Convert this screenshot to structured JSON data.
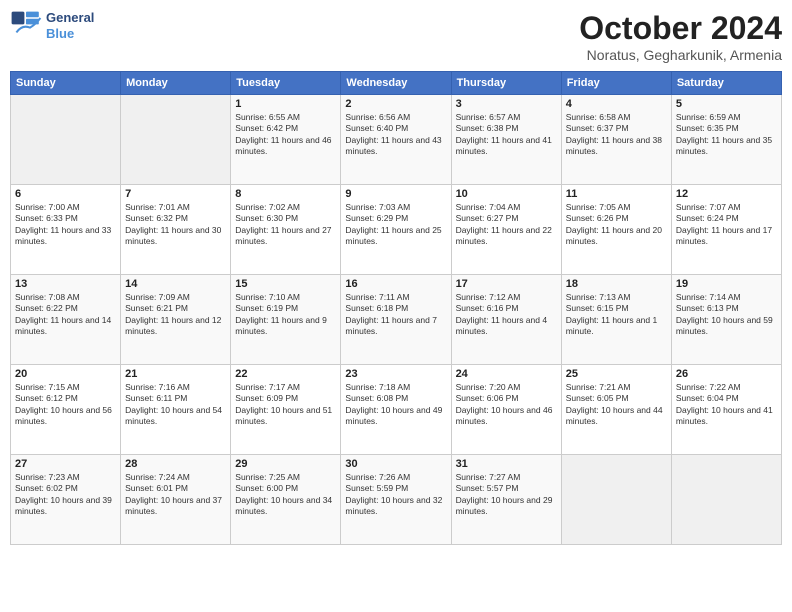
{
  "header": {
    "logo_line1": "General",
    "logo_line2": "Blue",
    "month": "October 2024",
    "location": "Noratus, Gegharkunik, Armenia"
  },
  "weekdays": [
    "Sunday",
    "Monday",
    "Tuesday",
    "Wednesday",
    "Thursday",
    "Friday",
    "Saturday"
  ],
  "weeks": [
    [
      {
        "day": "",
        "info": ""
      },
      {
        "day": "",
        "info": ""
      },
      {
        "day": "1",
        "info": "Sunrise: 6:55 AM\nSunset: 6:42 PM\nDaylight: 11 hours and 46 minutes."
      },
      {
        "day": "2",
        "info": "Sunrise: 6:56 AM\nSunset: 6:40 PM\nDaylight: 11 hours and 43 minutes."
      },
      {
        "day": "3",
        "info": "Sunrise: 6:57 AM\nSunset: 6:38 PM\nDaylight: 11 hours and 41 minutes."
      },
      {
        "day": "4",
        "info": "Sunrise: 6:58 AM\nSunset: 6:37 PM\nDaylight: 11 hours and 38 minutes."
      },
      {
        "day": "5",
        "info": "Sunrise: 6:59 AM\nSunset: 6:35 PM\nDaylight: 11 hours and 35 minutes."
      }
    ],
    [
      {
        "day": "6",
        "info": "Sunrise: 7:00 AM\nSunset: 6:33 PM\nDaylight: 11 hours and 33 minutes."
      },
      {
        "day": "7",
        "info": "Sunrise: 7:01 AM\nSunset: 6:32 PM\nDaylight: 11 hours and 30 minutes."
      },
      {
        "day": "8",
        "info": "Sunrise: 7:02 AM\nSunset: 6:30 PM\nDaylight: 11 hours and 27 minutes."
      },
      {
        "day": "9",
        "info": "Sunrise: 7:03 AM\nSunset: 6:29 PM\nDaylight: 11 hours and 25 minutes."
      },
      {
        "day": "10",
        "info": "Sunrise: 7:04 AM\nSunset: 6:27 PM\nDaylight: 11 hours and 22 minutes."
      },
      {
        "day": "11",
        "info": "Sunrise: 7:05 AM\nSunset: 6:26 PM\nDaylight: 11 hours and 20 minutes."
      },
      {
        "day": "12",
        "info": "Sunrise: 7:07 AM\nSunset: 6:24 PM\nDaylight: 11 hours and 17 minutes."
      }
    ],
    [
      {
        "day": "13",
        "info": "Sunrise: 7:08 AM\nSunset: 6:22 PM\nDaylight: 11 hours and 14 minutes."
      },
      {
        "day": "14",
        "info": "Sunrise: 7:09 AM\nSunset: 6:21 PM\nDaylight: 11 hours and 12 minutes."
      },
      {
        "day": "15",
        "info": "Sunrise: 7:10 AM\nSunset: 6:19 PM\nDaylight: 11 hours and 9 minutes."
      },
      {
        "day": "16",
        "info": "Sunrise: 7:11 AM\nSunset: 6:18 PM\nDaylight: 11 hours and 7 minutes."
      },
      {
        "day": "17",
        "info": "Sunrise: 7:12 AM\nSunset: 6:16 PM\nDaylight: 11 hours and 4 minutes."
      },
      {
        "day": "18",
        "info": "Sunrise: 7:13 AM\nSunset: 6:15 PM\nDaylight: 11 hours and 1 minute."
      },
      {
        "day": "19",
        "info": "Sunrise: 7:14 AM\nSunset: 6:13 PM\nDaylight: 10 hours and 59 minutes."
      }
    ],
    [
      {
        "day": "20",
        "info": "Sunrise: 7:15 AM\nSunset: 6:12 PM\nDaylight: 10 hours and 56 minutes."
      },
      {
        "day": "21",
        "info": "Sunrise: 7:16 AM\nSunset: 6:11 PM\nDaylight: 10 hours and 54 minutes."
      },
      {
        "day": "22",
        "info": "Sunrise: 7:17 AM\nSunset: 6:09 PM\nDaylight: 10 hours and 51 minutes."
      },
      {
        "day": "23",
        "info": "Sunrise: 7:18 AM\nSunset: 6:08 PM\nDaylight: 10 hours and 49 minutes."
      },
      {
        "day": "24",
        "info": "Sunrise: 7:20 AM\nSunset: 6:06 PM\nDaylight: 10 hours and 46 minutes."
      },
      {
        "day": "25",
        "info": "Sunrise: 7:21 AM\nSunset: 6:05 PM\nDaylight: 10 hours and 44 minutes."
      },
      {
        "day": "26",
        "info": "Sunrise: 7:22 AM\nSunset: 6:04 PM\nDaylight: 10 hours and 41 minutes."
      }
    ],
    [
      {
        "day": "27",
        "info": "Sunrise: 7:23 AM\nSunset: 6:02 PM\nDaylight: 10 hours and 39 minutes."
      },
      {
        "day": "28",
        "info": "Sunrise: 7:24 AM\nSunset: 6:01 PM\nDaylight: 10 hours and 37 minutes."
      },
      {
        "day": "29",
        "info": "Sunrise: 7:25 AM\nSunset: 6:00 PM\nDaylight: 10 hours and 34 minutes."
      },
      {
        "day": "30",
        "info": "Sunrise: 7:26 AM\nSunset: 5:59 PM\nDaylight: 10 hours and 32 minutes."
      },
      {
        "day": "31",
        "info": "Sunrise: 7:27 AM\nSunset: 5:57 PM\nDaylight: 10 hours and 29 minutes."
      },
      {
        "day": "",
        "info": ""
      },
      {
        "day": "",
        "info": ""
      }
    ]
  ]
}
